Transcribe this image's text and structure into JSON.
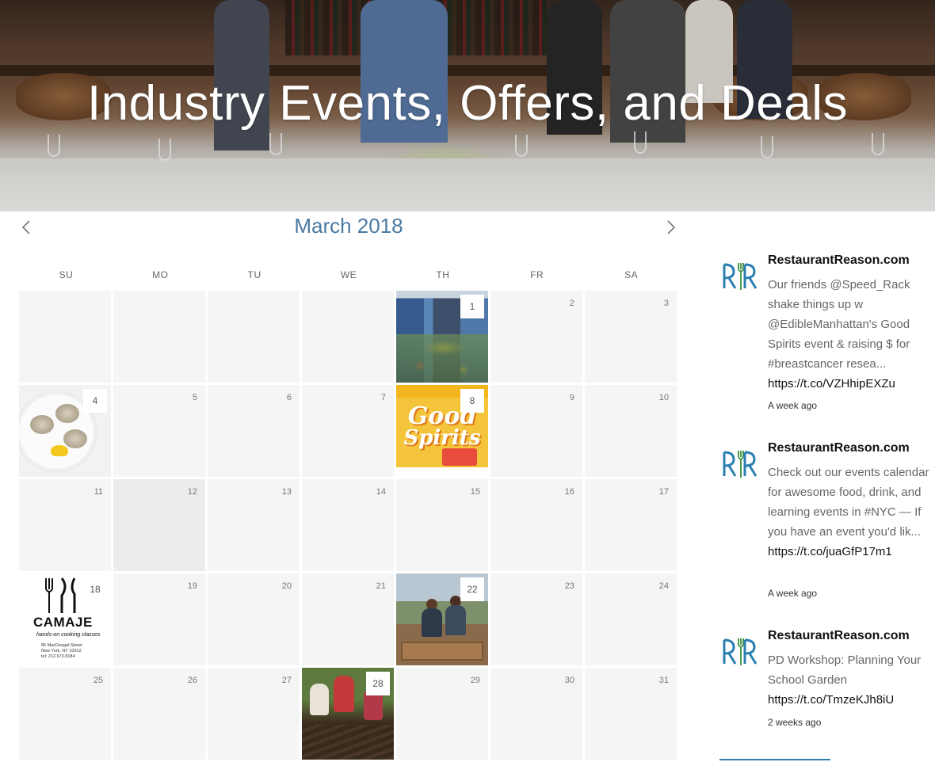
{
  "hero": {
    "title": "Industry Events, Offers, and Deals"
  },
  "calendar": {
    "month_label": "March 2018",
    "prev_label": "previous month",
    "next_label": "next month",
    "weekdays": [
      "SU",
      "MO",
      "TU",
      "WE",
      "TH",
      "FR",
      "SA"
    ],
    "weeks": [
      [
        null,
        null,
        null,
        null,
        "1",
        "2",
        "3"
      ],
      [
        "4",
        "5",
        "6",
        "7",
        "8",
        "9",
        "10"
      ],
      [
        "11",
        "12",
        "13",
        "14",
        "15",
        "16",
        "17"
      ],
      [
        "18",
        "19",
        "20",
        "21",
        "22",
        "23",
        "24"
      ],
      [
        "25",
        "26",
        "27",
        "28",
        "29",
        "30",
        "31"
      ]
    ],
    "event_days": [
      "1",
      "4",
      "8",
      "18",
      "22",
      "28"
    ],
    "highlighted_day": "12",
    "images": {
      "spirits_line1": "Good",
      "spirits_line2": "Spirits",
      "camaje_brand": "CAMAJE",
      "camaje_tag": "hands-on cooking classes",
      "camaje_addr1": "85 MacDougal Street",
      "camaje_addr2": "New York, NY 10012",
      "camaje_addr3": "tel: 212.673.8184"
    }
  },
  "feed": {
    "colors": {
      "logo_blue": "#2a7fb0",
      "logo_green": "#4f9a4a"
    },
    "tweets": [
      {
        "handle": "RestaurantReason.com",
        "text": "Our friends @Speed_Rack shake things up w @EdibleManhattan's Good Spirits event & raising $ for #breastcancer resea...",
        "link": "https://t.co/VZHhipEXZu",
        "when": "A week ago"
      },
      {
        "handle": "RestaurantReason.com",
        "text": "Check out our events calendar for awesome food, drink, and learning events in #NYC — If you have an event you'd lik...",
        "link": "https://t.co/juaGfP17m1",
        "when": "A week ago"
      },
      {
        "handle": "RestaurantReason.com",
        "text": "PD Workshop: Planning Your School Garden",
        "link": "https://t.co/TmzeKJh8iU",
        "when": "2 weeks ago"
      }
    ]
  }
}
